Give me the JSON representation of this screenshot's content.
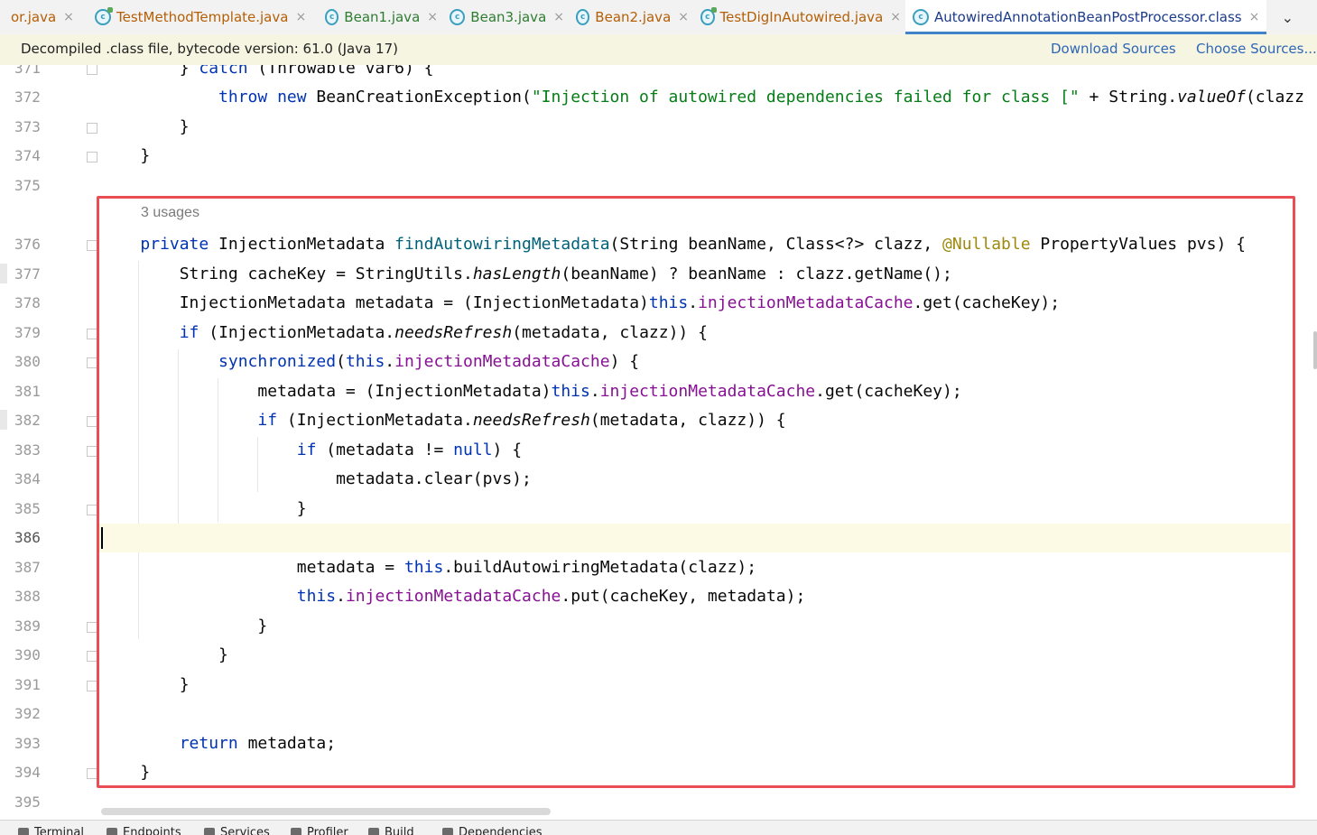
{
  "tabs": [
    {
      "label": "or.java",
      "kind": "partial",
      "color": "orange"
    },
    {
      "label": "TestMethodTemplate.java",
      "kind": "test",
      "color": "orange"
    },
    {
      "label": "Bean1.java",
      "kind": "class",
      "color": "green"
    },
    {
      "label": "Bean3.java",
      "kind": "class",
      "color": "green"
    },
    {
      "label": "Bean2.java",
      "kind": "class",
      "color": "orange"
    },
    {
      "label": "TestDigInAutowired.java",
      "kind": "test",
      "color": "orange"
    },
    {
      "label": "AutowiredAnnotationBeanPostProcessor.class",
      "kind": "class",
      "color": "blue",
      "active": true
    }
  ],
  "tab_close_glyph": "×",
  "tab_class_glyph": "c",
  "tab_overflow_glyph": "⌄",
  "banner": {
    "message": "Decompiled .class file, bytecode version: 61.0 (Java 17)",
    "download_sources": "Download Sources",
    "choose_sources": "Choose Sources..."
  },
  "editor": {
    "usages_hint": "3 usages",
    "current_line": "386",
    "lines": [
      {
        "n": "371",
        "tokens": [
          [
            "",
            "        "
          ],
          [
            "",
            "} "
          ],
          [
            "kw",
            "catch"
          ],
          [
            "",
            " (Throwable var6) {"
          ]
        ]
      },
      {
        "n": "372",
        "tokens": [
          [
            "",
            "            "
          ],
          [
            "kw",
            "throw"
          ],
          [
            "",
            " "
          ],
          [
            "kw",
            "new"
          ],
          [
            "",
            " BeanCreationException("
          ],
          [
            "str",
            "\"Injection of autowired dependencies failed for class [\""
          ],
          [
            "",
            " + String."
          ],
          [
            "it",
            "valueOf"
          ],
          [
            "",
            "(clazz"
          ]
        ]
      },
      {
        "n": "373",
        "tokens": [
          [
            "",
            "        }"
          ]
        ]
      },
      {
        "n": "374",
        "tokens": [
          [
            "",
            "    }"
          ]
        ]
      },
      {
        "n": "375",
        "tokens": []
      },
      {
        "n": "376",
        "tokens": [
          [
            "",
            "    "
          ],
          [
            "kw",
            "private"
          ],
          [
            "",
            " InjectionMetadata "
          ],
          [
            "meth",
            "findAutowiringMetadata"
          ],
          [
            "",
            "(String beanName, Class<?> clazz, "
          ],
          [
            "ann",
            "@Nullable"
          ],
          [
            "",
            " PropertyValues pvs) {"
          ]
        ]
      },
      {
        "n": "377",
        "tokens": [
          [
            "",
            "        String cacheKey = StringUtils."
          ],
          [
            "it",
            "hasLength"
          ],
          [
            "",
            "(beanName) ? beanName : clazz.getName();"
          ]
        ]
      },
      {
        "n": "378",
        "tokens": [
          [
            "",
            "        InjectionMetadata metadata = (InjectionMetadata)"
          ],
          [
            "kw",
            "this"
          ],
          [
            "",
            "."
          ],
          [
            "fld",
            "injectionMetadataCache"
          ],
          [
            "",
            ".get(cacheKey);"
          ]
        ]
      },
      {
        "n": "379",
        "tokens": [
          [
            "",
            "        "
          ],
          [
            "kw",
            "if"
          ],
          [
            "",
            " (InjectionMetadata."
          ],
          [
            "it",
            "needsRefresh"
          ],
          [
            "",
            "(metadata, clazz)) {"
          ]
        ]
      },
      {
        "n": "380",
        "tokens": [
          [
            "",
            "            "
          ],
          [
            "kw",
            "synchronized"
          ],
          [
            "",
            "("
          ],
          [
            "kw",
            "this"
          ],
          [
            "",
            "."
          ],
          [
            "fld",
            "injectionMetadataCache"
          ],
          [
            "",
            ") {"
          ]
        ]
      },
      {
        "n": "381",
        "tokens": [
          [
            "",
            "                metadata = (InjectionMetadata)"
          ],
          [
            "kw",
            "this"
          ],
          [
            "",
            "."
          ],
          [
            "fld",
            "injectionMetadataCache"
          ],
          [
            "",
            ".get(cacheKey);"
          ]
        ]
      },
      {
        "n": "382",
        "tokens": [
          [
            "",
            "                "
          ],
          [
            "kw",
            "if"
          ],
          [
            "",
            " (InjectionMetadata."
          ],
          [
            "it",
            "needsRefresh"
          ],
          [
            "",
            "(metadata, clazz)) {"
          ]
        ]
      },
      {
        "n": "383",
        "tokens": [
          [
            "",
            "                    "
          ],
          [
            "kw",
            "if"
          ],
          [
            "",
            " (metadata != "
          ],
          [
            "kw",
            "null"
          ],
          [
            "",
            ") {"
          ]
        ]
      },
      {
        "n": "384",
        "tokens": [
          [
            "",
            "                        metadata.clear(pvs);"
          ]
        ]
      },
      {
        "n": "385",
        "tokens": [
          [
            "",
            "                    }"
          ]
        ]
      },
      {
        "n": "386",
        "tokens": []
      },
      {
        "n": "387",
        "tokens": [
          [
            "",
            "                    metadata = "
          ],
          [
            "kw",
            "this"
          ],
          [
            "",
            ".buildAutowiringMetadata(clazz);"
          ]
        ]
      },
      {
        "n": "388",
        "tokens": [
          [
            "",
            "                    "
          ],
          [
            "kw",
            "this"
          ],
          [
            "",
            "."
          ],
          [
            "fld",
            "injectionMetadataCache"
          ],
          [
            "",
            ".put(cacheKey, metadata);"
          ]
        ]
      },
      {
        "n": "389",
        "tokens": [
          [
            "",
            "                }"
          ]
        ]
      },
      {
        "n": "390",
        "tokens": [
          [
            "",
            "            }"
          ]
        ]
      },
      {
        "n": "391",
        "tokens": [
          [
            "",
            "        }"
          ]
        ]
      },
      {
        "n": "392",
        "tokens": []
      },
      {
        "n": "393",
        "tokens": [
          [
            "",
            "        "
          ],
          [
            "kw",
            "return"
          ],
          [
            "",
            " metadata;"
          ]
        ]
      },
      {
        "n": "394",
        "tokens": [
          [
            "",
            "    }"
          ]
        ]
      },
      {
        "n": "395",
        "tokens": []
      }
    ]
  },
  "bottom_tools": [
    "Terminal",
    "Endpoints",
    "Services",
    "Profiler",
    "Build",
    "Dependencies"
  ],
  "colors": {
    "keyword": "#0033b3",
    "field": "#871094",
    "string": "#067d17",
    "annotation": "#9e880d",
    "method": "#00627a",
    "highlight_box": "#eb4d55",
    "current_line_bg": "#fcfae5"
  }
}
